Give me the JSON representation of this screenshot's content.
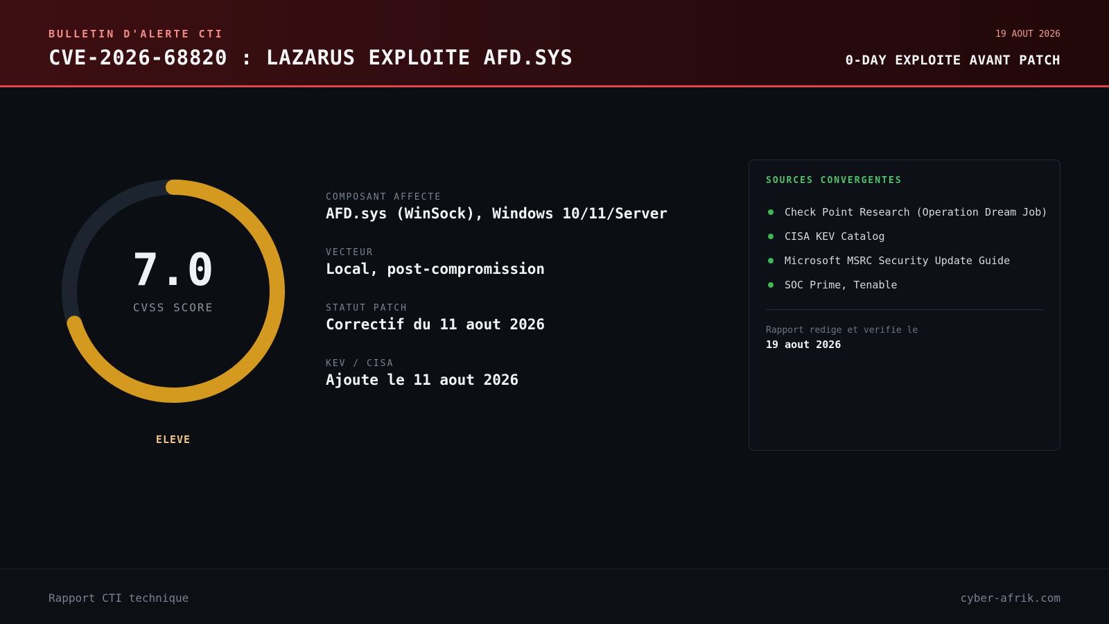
{
  "header": {
    "kicker": "BULLETIN D'ALERTE CTI",
    "title": "CVE-2026-68820 : LAZARUS EXPLOITE AFD.SYS",
    "date": "19 AOUT 2026",
    "tagline": "0-DAY EXPLOITE AVANT PATCH"
  },
  "gauge": {
    "score": "7.0",
    "score_value": 7.0,
    "score_max": 10,
    "label": "CVSS SCORE",
    "severity": "ELEVE",
    "arc_color": "#d4991f",
    "track_color": "#1c252f"
  },
  "details": [
    {
      "label": "COMPOSANT AFFECTE",
      "value": "AFD.sys (WinSock), Windows 10/11/Server"
    },
    {
      "label": "VECTEUR",
      "value": "Local, post-compromission"
    },
    {
      "label": "STATUT PATCH",
      "value": "Correctif du 11 aout 2026"
    },
    {
      "label": "KEV / CISA",
      "value": "Ajoute le 11 aout 2026"
    }
  ],
  "sources": {
    "title": "SOURCES CONVERGENTES",
    "items": [
      "Check Point Research (Operation Dream Job)",
      "CISA KEV Catalog",
      "Microsoft MSRC Security Update Guide",
      "SOC Prime, Tenable"
    ],
    "verified_label": "Rapport redige et verifie le",
    "verified_date": "19 aout 2026"
  },
  "footer": {
    "left": "Rapport CTI technique",
    "right": "cyber-afrik.com"
  }
}
